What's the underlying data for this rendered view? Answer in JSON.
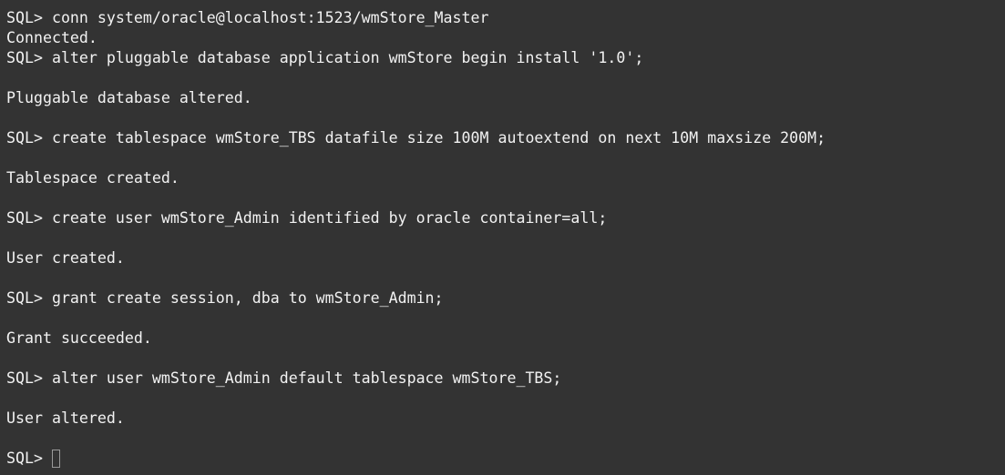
{
  "terminal": {
    "lines": [
      "SQL> conn system/oracle@localhost:1523/wmStore_Master",
      "Connected.",
      "SQL> alter pluggable database application wmStore begin install '1.0';",
      "",
      "Pluggable database altered.",
      "",
      "SQL> create tablespace wmStore_TBS datafile size 100M autoextend on next 10M maxsize 200M;",
      "",
      "Tablespace created.",
      "",
      "SQL> create user wmStore_Admin identified by oracle container=all;",
      "",
      "User created.",
      "",
      "SQL> grant create session, dba to wmStore_Admin;",
      "",
      "Grant succeeded.",
      "",
      "SQL> alter user wmStore_Admin default tablespace wmStore_TBS;",
      "",
      "User altered.",
      ""
    ],
    "prompt": "SQL> ",
    "colors": {
      "background": "#333333",
      "text": "#f2f2f2",
      "cursor_border": "#9a9a9a"
    }
  }
}
